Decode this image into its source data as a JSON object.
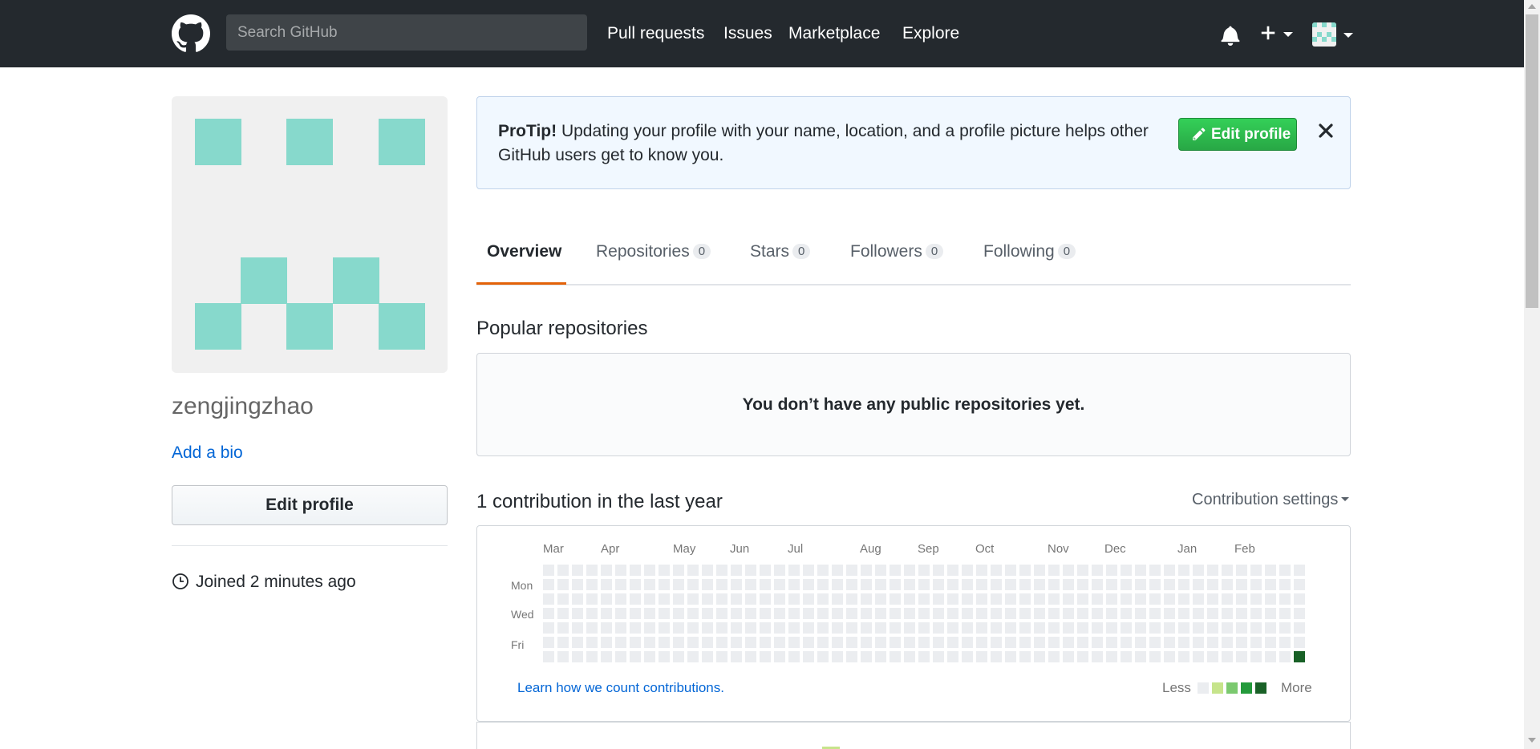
{
  "header": {
    "search_placeholder": "Search GitHub",
    "nav": [
      "Pull requests",
      "Issues",
      "Marketplace",
      "Explore"
    ],
    "icons": {
      "logo": "github-octocat-icon",
      "notifications": "bell-icon",
      "create": "plus-icon",
      "profile": "avatar-icon"
    }
  },
  "profile": {
    "username": "zengjingzhao",
    "add_bio": "Add a bio",
    "edit_profile": "Edit profile",
    "joined": "Joined 2 minutes ago"
  },
  "protip": {
    "label": "ProTip!",
    "text": " Updating your profile with your name, location, and a profile picture helps other GitHub users get to know you.",
    "edit_button": "Edit profile"
  },
  "tabs": [
    {
      "label": "Overview",
      "count": null,
      "active": true
    },
    {
      "label": "Repositories",
      "count": "0",
      "active": false
    },
    {
      "label": "Stars",
      "count": "0",
      "active": false
    },
    {
      "label": "Followers",
      "count": "0",
      "active": false
    },
    {
      "label": "Following",
      "count": "0",
      "active": false
    }
  ],
  "popular": {
    "title": "Popular repositories",
    "empty_message": "You don’t have any public repositories yet."
  },
  "contributions": {
    "title": "1 contribution in the last year",
    "settings": "Contribution settings",
    "months": [
      "Mar",
      "Apr",
      "May",
      "Jun",
      "Jul",
      "Aug",
      "Sep",
      "Oct",
      "Nov",
      "Dec",
      "Jan",
      "Feb"
    ],
    "day_labels": [
      "Mon",
      "Wed",
      "Fri"
    ],
    "learn_link": "Learn how we count contributions.",
    "legend_less": "Less",
    "legend_more": "More",
    "weeks": 53,
    "days_per_week": 7,
    "contribution_week": 52,
    "contribution_day": 6
  },
  "colors": {
    "header_bg": "#24292e",
    "avatar_teal": "#87d9cc",
    "link": "#0366d6",
    "green_button": "#28a745",
    "tab_accent": "#e36209",
    "cell_empty": "#ebedf0",
    "legend": [
      "#ebedf0",
      "#c6e48b",
      "#7bc96f",
      "#239a3b",
      "#196127"
    ]
  }
}
